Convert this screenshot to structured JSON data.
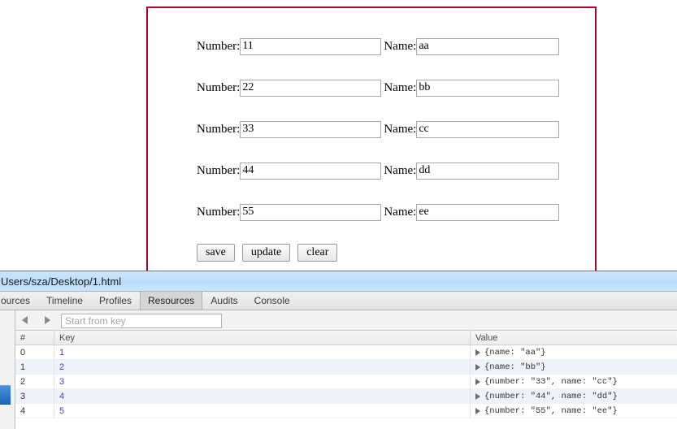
{
  "page": {
    "rows": [
      {
        "number_label": "Number:",
        "number_value": "11",
        "name_label": "Name:",
        "name_value": "aa"
      },
      {
        "number_label": "Number:",
        "number_value": "22",
        "name_label": "Name:",
        "name_value": "bb"
      },
      {
        "number_label": "Number:",
        "number_value": "33",
        "name_label": "Name:",
        "name_value": "cc"
      },
      {
        "number_label": "Number:",
        "number_value": "44",
        "name_label": "Name:",
        "name_value": "dd"
      },
      {
        "number_label": "Number:",
        "number_value": "55",
        "name_label": "Name:",
        "name_value": "ee"
      }
    ],
    "buttons": [
      {
        "label": "save"
      },
      {
        "label": "update"
      },
      {
        "label": "clear"
      }
    ],
    "border_color": "#9e0b2b"
  },
  "devtools": {
    "title": "Users/sza/Desktop/1.html",
    "tabs": [
      {
        "label": "ources",
        "active": false
      },
      {
        "label": "Timeline",
        "active": false
      },
      {
        "label": "Profiles",
        "active": false
      },
      {
        "label": "Resources",
        "active": true
      },
      {
        "label": "Audits",
        "active": false
      },
      {
        "label": "Console",
        "active": false
      }
    ],
    "toolbar": {
      "back_icon": "triangle-left-icon",
      "forward_icon": "triangle-right-icon",
      "search_placeholder": "Start from key",
      "search_value": ""
    },
    "table": {
      "columns": [
        "#",
        "Key",
        "Value"
      ],
      "rows": [
        {
          "index": "0",
          "key": "1",
          "value": "{name: \"aa\"}"
        },
        {
          "index": "1",
          "key": "2",
          "value": "{name: \"bb\"}"
        },
        {
          "index": "2",
          "key": "3",
          "value": "{number: \"33\", name: \"cc\"}"
        },
        {
          "index": "3",
          "key": "4",
          "value": "{number: \"44\", name: \"dd\"}"
        },
        {
          "index": "4",
          "key": "5",
          "value": "{number: \"55\", name: \"ee\"}"
        }
      ]
    },
    "key_color": "#4c3fbe",
    "titlebar_color": "#b9dcfb"
  }
}
